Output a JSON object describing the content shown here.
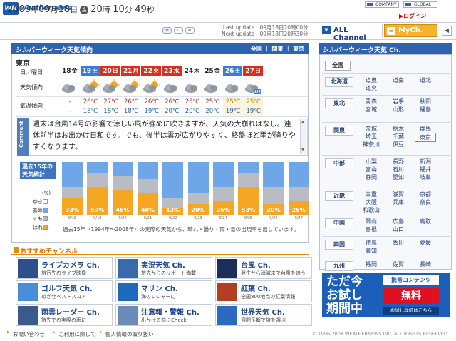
{
  "header": {
    "logo_mark": "WN",
    "logo_text": "weathernews",
    "company": "COMPANY",
    "global": "GLOBAL",
    "login": "▶ログイン"
  },
  "datebar": {
    "year": "2009",
    "year_unit": "年",
    "month": "09",
    "month_unit": "月",
    "day": "18",
    "day_unit": "日",
    "weekday": "金",
    "hour": "20",
    "hour_unit": "時",
    "minute": "10",
    "minute_unit": "分",
    "second": "49",
    "second_unit": "秒",
    "size_m": "M",
    "size_l": "L",
    "size_xl": "XL",
    "last_update_label": "Last update",
    "last_update": "09月18日20時00分",
    "next_update_label": "Next update",
    "next_update": "09月18日20時30分",
    "all_channel": "ALL Channel",
    "mych": "MyCh.",
    "nav_arrow": "◀"
  },
  "main": {
    "title": "シルバーウィーク天気傾向",
    "region_links": "全国 ｜ 関東 ｜ 東京",
    "city": "東京",
    "row_labels": {
      "date": "日／曜日",
      "weather": "天気傾向",
      "temp": "気温傾向"
    },
    "days": [
      {
        "d": "18",
        "w": "金",
        "color": "#222",
        "bg": "#fff",
        "icon": "cloudy",
        "hi": "-",
        "lo": "-"
      },
      {
        "d": "19",
        "w": "土",
        "color": "#fff",
        "bg": "#3a7bd5",
        "icon": "sun-cloud",
        "hi": "26℃",
        "lo": "18℃"
      },
      {
        "d": "20",
        "w": "日",
        "color": "#fff",
        "bg": "#e02b1f",
        "icon": "cloud-sun",
        "hi": "27℃",
        "lo": "18℃"
      },
      {
        "d": "21",
        "w": "月",
        "color": "#fff",
        "bg": "#e02b1f",
        "icon": "sun-cloud",
        "hi": "26℃",
        "lo": "18℃"
      },
      {
        "d": "22",
        "w": "火",
        "color": "#fff",
        "bg": "#e02b1f",
        "icon": "sun-cloud",
        "hi": "26℃",
        "lo": "19℃"
      },
      {
        "d": "23",
        "w": "水",
        "color": "#fff",
        "bg": "#e02b1f",
        "icon": "cloudy",
        "hi": "26℃",
        "lo": "20℃"
      },
      {
        "d": "24",
        "w": "木",
        "color": "#222",
        "bg": "#fff",
        "icon": "cloudy",
        "hi": "25℃",
        "lo": "20℃"
      },
      {
        "d": "25",
        "w": "金",
        "color": "#222",
        "bg": "#fff",
        "icon": "cloudy",
        "hi": "25℃",
        "lo": "20℃"
      },
      {
        "d": "26",
        "w": "土",
        "color": "#fff",
        "bg": "#3a7bd5",
        "icon": "cloudy",
        "hi": "25℃",
        "lo": "19℃"
      },
      {
        "d": "27",
        "w": "日",
        "color": "#fff",
        "bg": "#e02b1f",
        "icon": "cloud-rain",
        "hi": "25℃",
        "lo": "19℃"
      }
    ],
    "comment_tab": "Comment",
    "comment": "週末は台風14号の影響で涼しい風が強めに吹きますが、天気の大崩れはなし。連休前半はお出かけ日和です。でも、後半は雲が広がりやすく、終盤ほど雨が降りやすくなります。",
    "stats_label_1": "過去15年の",
    "stats_label_2": "天気統計",
    "legend_pct": "(%)",
    "legend": [
      {
        "label": "ゆき",
        "color": "#ffffff"
      },
      {
        "label": "あめ",
        "color": "#6fa6e8"
      },
      {
        "label": "くもり",
        "color": "#b9bcc2"
      },
      {
        "label": "はれ",
        "color": "#f5a623"
      }
    ],
    "stats": [
      {
        "date": "9/18",
        "sun": 33,
        "cloud": 20,
        "rain": 47
      },
      {
        "date": "9/19",
        "sun": 53,
        "cloud": 27,
        "rain": 20
      },
      {
        "date": "9/20",
        "sun": 46,
        "cloud": 27,
        "rain": 27
      },
      {
        "date": "9/21",
        "sun": 40,
        "cloud": 27,
        "rain": 33
      },
      {
        "date": "9/22",
        "sun": 13,
        "cloud": 20,
        "rain": 67
      },
      {
        "date": "9/23",
        "sun": 20,
        "cloud": 20,
        "rain": 60
      },
      {
        "date": "9/24",
        "sun": 26,
        "cloud": 27,
        "rain": 47
      },
      {
        "date": "9/25",
        "sun": 53,
        "cloud": 27,
        "rain": 20
      },
      {
        "date": "9/26",
        "sun": 20,
        "cloud": 33,
        "rain": 47
      },
      {
        "date": "9/27",
        "sun": 26,
        "cloud": 27,
        "rain": 47
      }
    ],
    "stats_note": "過去15年（1994年〜2008年）の実際の天気から、晴れ・曇り・雨・雪の出現率を出しています。"
  },
  "channels": {
    "title": "おすすめチャンネル",
    "items": [
      {
        "name": "ライブカメラ Ch.",
        "desc": "旅行先のライブ映像",
        "thumb": "#2d4f8a"
      },
      {
        "name": "実況天気 Ch.",
        "desc": "旅先からのリポート満載",
        "thumb": "#3a6aa8"
      },
      {
        "name": "台風 Ch.",
        "desc": "発生から消滅まで台風を追う",
        "thumb": "#1d2d5a"
      },
      {
        "name": "ゴルフ天気 Ch.",
        "desc": "めざせベストスコア",
        "thumb": "#4a8ed8"
      },
      {
        "name": "マリン Ch.",
        "desc": "海のレジャーに",
        "thumb": "#1f6ab8"
      },
      {
        "name": "紅葉 Ch.",
        "desc": "全国800地点の紅葉情報",
        "thumb": "#b04020"
      },
      {
        "name": "雨雲レーダー Ch.",
        "desc": "旅先での実際の雨に",
        "thumb": "#3a5a8a"
      },
      {
        "name": "注意報・警報 Ch.",
        "desc": "出かける前にCheck",
        "thumb": "#6a8ab8"
      },
      {
        "name": "世界天気 Ch.",
        "desc": "週間予報で旅を選ぶ",
        "thumb": "#2a6ac0"
      }
    ]
  },
  "right_panel": {
    "title": "シルバーウィーク天気 Ch.",
    "nationwide": "全国",
    "regions": [
      {
        "name": "北海道",
        "prefs": [
          "道東",
          "道南",
          "道北",
          "道央"
        ]
      },
      {
        "name": "東北",
        "prefs": [
          "青森",
          "岩手",
          "秋田",
          "宮城",
          "山形",
          "福島"
        ]
      },
      {
        "name": "関東",
        "prefs": [
          "茨城",
          "栃木",
          "群馬",
          "埼玉",
          "千葉",
          "東京",
          "神奈川",
          "伊豆"
        ]
      },
      {
        "name": "中部",
        "prefs": [
          "山梨",
          "長野",
          "新潟",
          "富山",
          "石川",
          "福井",
          "静岡",
          "愛知",
          "岐阜"
        ]
      },
      {
        "name": "近畿",
        "prefs": [
          "三重",
          "滋賀",
          "京都",
          "大阪",
          "兵庫",
          "奈良",
          "和歌山"
        ]
      },
      {
        "name": "中国",
        "prefs": [
          "岡山",
          "広島",
          "鳥取",
          "島根",
          "山口"
        ]
      },
      {
        "name": "四国",
        "prefs": [
          "徳島",
          "香川",
          "愛媛",
          "高知"
        ]
      },
      {
        "name": "九州",
        "prefs": [
          "福岡",
          "佐賀",
          "長崎"
        ]
      }
    ],
    "selected_pref": "東京"
  },
  "ad": {
    "line1": "ただ今",
    "line2": "お試し",
    "line3": "期間中",
    "badge": "携帯コンテンツ",
    "free": "無料",
    "detail": "お試し詳細はこちら"
  },
  "footer": {
    "link1": "お問い合わせ",
    "link2": "ご利用に際して",
    "link3": "個人情報の取り扱い",
    "copyright": "© 1996-2008 WEATHERNEWS INC. ALL RIGHTS RESERVED."
  }
}
